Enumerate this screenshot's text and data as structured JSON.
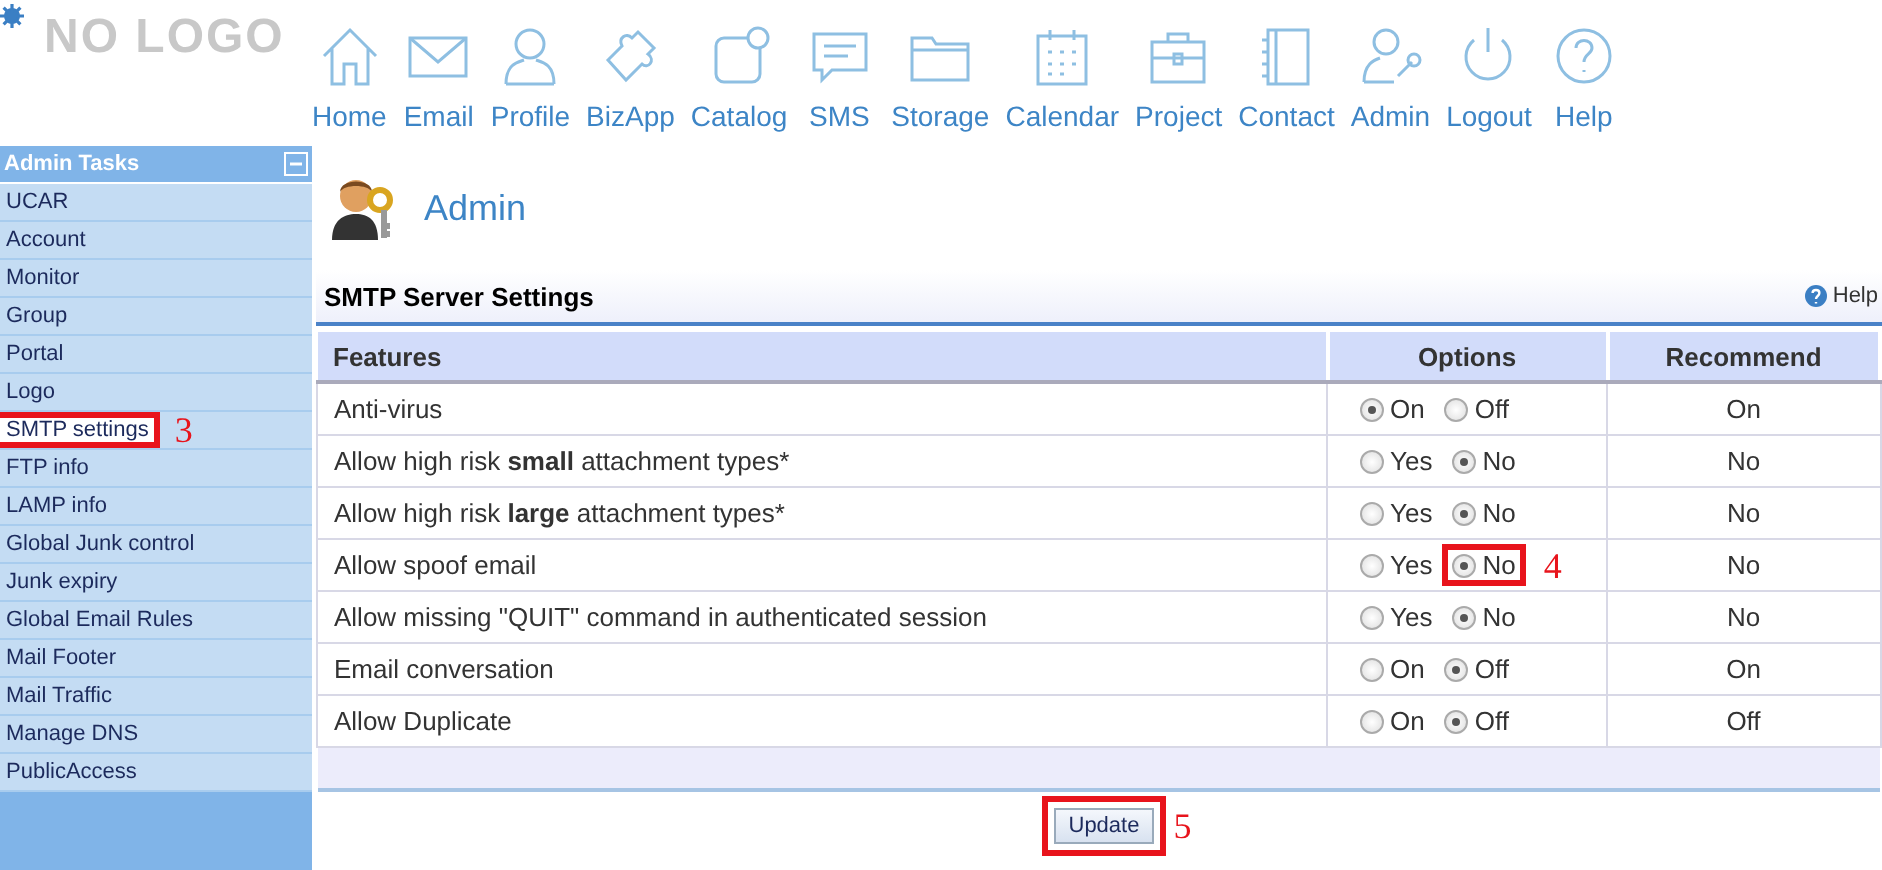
{
  "logo": {
    "text": "NO LOGO"
  },
  "nav": [
    {
      "label": "Home"
    },
    {
      "label": "Email"
    },
    {
      "label": "Profile"
    },
    {
      "label": "BizApp"
    },
    {
      "label": "Catalog"
    },
    {
      "label": "SMS"
    },
    {
      "label": "Storage"
    },
    {
      "label": "Calendar"
    },
    {
      "label": "Project"
    },
    {
      "label": "Contact"
    },
    {
      "label": "Admin"
    },
    {
      "label": "Logout"
    },
    {
      "label": "Help"
    }
  ],
  "sidebar": {
    "title": "Admin Tasks",
    "items": [
      {
        "label": "UCAR"
      },
      {
        "label": "Account"
      },
      {
        "label": "Monitor"
      },
      {
        "label": "Group"
      },
      {
        "label": "Portal"
      },
      {
        "label": "Logo"
      },
      {
        "label": "SMTP settings",
        "callout": "3"
      },
      {
        "label": "FTP info"
      },
      {
        "label": "LAMP info"
      },
      {
        "label": "Global Junk control"
      },
      {
        "label": "Junk expiry"
      },
      {
        "label": "Global Email Rules"
      },
      {
        "label": "Mail Footer"
      },
      {
        "label": "Mail Traffic"
      },
      {
        "label": "Manage DNS"
      },
      {
        "label": "PublicAccess"
      }
    ]
  },
  "page": {
    "title": "Admin"
  },
  "section": {
    "title": "SMTP Server Settings",
    "help": "Help"
  },
  "table": {
    "columns": [
      "Features",
      "Options",
      "Recommend"
    ],
    "rows": [
      {
        "feature": "Anti-virus",
        "options": [
          {
            "label": "On",
            "selected": true
          },
          {
            "label": "Off",
            "selected": false
          }
        ],
        "recommend": "On"
      },
      {
        "feature": "Allow high risk **small** attachment types*",
        "options": [
          {
            "label": "Yes",
            "selected": false
          },
          {
            "label": "No",
            "selected": true
          }
        ],
        "recommend": "No"
      },
      {
        "feature": "Allow high risk **large** attachment types*",
        "options": [
          {
            "label": "Yes",
            "selected": false
          },
          {
            "label": "No",
            "selected": true
          }
        ],
        "recommend": "No"
      },
      {
        "feature": "Allow spoof email",
        "options": [
          {
            "label": "Yes",
            "selected": false
          },
          {
            "label": "No",
            "selected": true,
            "callout": "4"
          }
        ],
        "recommend": "No"
      },
      {
        "feature": "Allow missing \"QUIT\" command in authenticated session",
        "options": [
          {
            "label": "Yes",
            "selected": false
          },
          {
            "label": "No",
            "selected": true
          }
        ],
        "recommend": "No"
      },
      {
        "feature": "Email conversation",
        "options": [
          {
            "label": "On",
            "selected": false
          },
          {
            "label": "Off",
            "selected": true
          }
        ],
        "recommend": "On"
      },
      {
        "feature": "Allow Duplicate",
        "options": [
          {
            "label": "On",
            "selected": false
          },
          {
            "label": "Off",
            "selected": true
          }
        ],
        "recommend": "Off"
      }
    ]
  },
  "update_button": {
    "label": "Update",
    "callout": "5"
  }
}
